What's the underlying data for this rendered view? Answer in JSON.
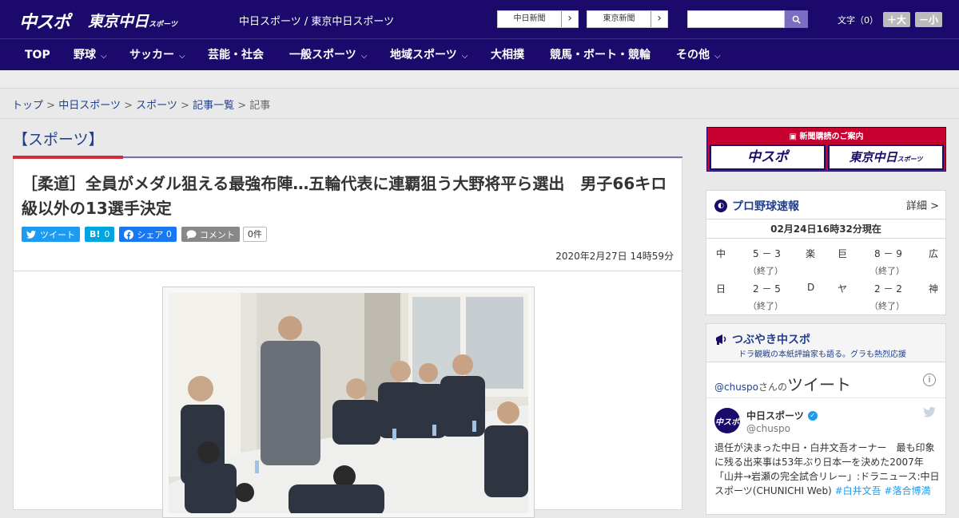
{
  "header": {
    "logo": "中スポ",
    "logo2_main": "東京中日",
    "logo2_small": "スポーツ",
    "site_names": "中日スポーツ / 東京中日スポーツ",
    "paper_buttons": [
      "中日新聞",
      "東京新聞"
    ],
    "search_placeholder": "",
    "font_label": "文字（0）",
    "font_up": "＋大",
    "font_down": "－小"
  },
  "nav": {
    "items": [
      {
        "label": "TOP",
        "dropdown": false
      },
      {
        "label": "野球",
        "dropdown": true
      },
      {
        "label": "サッカー",
        "dropdown": true
      },
      {
        "label": "芸能・社会",
        "dropdown": false
      },
      {
        "label": "一般スポーツ",
        "dropdown": true
      },
      {
        "label": "地域スポーツ",
        "dropdown": true
      },
      {
        "label": "大相撲",
        "dropdown": false
      },
      {
        "label": "競馬・ボート・競輪",
        "dropdown": false
      },
      {
        "label": "その他",
        "dropdown": true
      }
    ]
  },
  "breadcrumb": {
    "links": [
      "トップ",
      "中日スポーツ",
      "スポーツ",
      "記事一覧"
    ],
    "current": "記事",
    "separator": ">"
  },
  "article": {
    "section": "【スポーツ】",
    "headline": "［柔道］全員がメダル狙える最強布陣…五輪代表に連覇狙う大野将平ら選出　男子66キロ級以外の13選手決定",
    "share": {
      "tweet": "ツイート",
      "hatena_count": "0",
      "facebook": "シェア",
      "facebook_count": "0",
      "comment": "コメント",
      "comment_count": "0件"
    },
    "date": "2020年2月27日 14時59分"
  },
  "sidebar": {
    "ad": {
      "title": "新聞購読のご案内",
      "btn1": "中スポ",
      "btn2_main": "東京中日",
      "btn2_small": "スポーツ"
    },
    "baseball": {
      "title": "プロ野球速報",
      "more": "詳細 >",
      "time": "02月24日16時32分現在",
      "games": [
        {
          "home": "中",
          "score": "5 － 3",
          "away": "楽",
          "status": "（終了）"
        },
        {
          "home": "巨",
          "score": "8 － 9",
          "away": "広",
          "status": "（終了）"
        },
        {
          "home": "日",
          "score": "2 － 5",
          "away": "D",
          "status": "（終了）"
        },
        {
          "home": "ヤ",
          "score": "2 － 2",
          "away": "神",
          "status": "（終了）"
        }
      ]
    },
    "tweets": {
      "title": "つぶやき中スポ",
      "subtitle": "ドラ観戦の本紙評論家も語る。グラも熱烈応援",
      "timeline_handle": "@chuspo",
      "timeline_suffix": "さんの",
      "timeline_word": "ツイート",
      "account_name": "中日スポーツ",
      "account_handle": "@chuspo",
      "avatar_text": "中スポ",
      "text": "退任が決まった中日・白井文吾オーナー　最も印象に残る出来事は53年ぶり日本一を決めた2007年「山井→岩瀬の完全試合リレー」:ドラニュース:中日スポーツ(CHUNICHI Web) ",
      "tags": "#白井文吾 #落合博満"
    }
  },
  "colors": {
    "navy": "#1b0a6b",
    "accent_red": "#d32b3b",
    "link_blue": "#23408e",
    "twitter_blue": "#1d9bf0",
    "facebook_blue": "#1877f2",
    "hatena_blue": "#00a4de",
    "comment_gray": "#888888"
  },
  "icons": [
    "search-icon",
    "chevron-right-icon",
    "chevron-down-icon",
    "twitter-bird-icon",
    "facebook-icon",
    "comment-icon",
    "baseball-icon",
    "megaphone-icon",
    "info-icon",
    "verified-icon",
    "newspaper-icon"
  ]
}
